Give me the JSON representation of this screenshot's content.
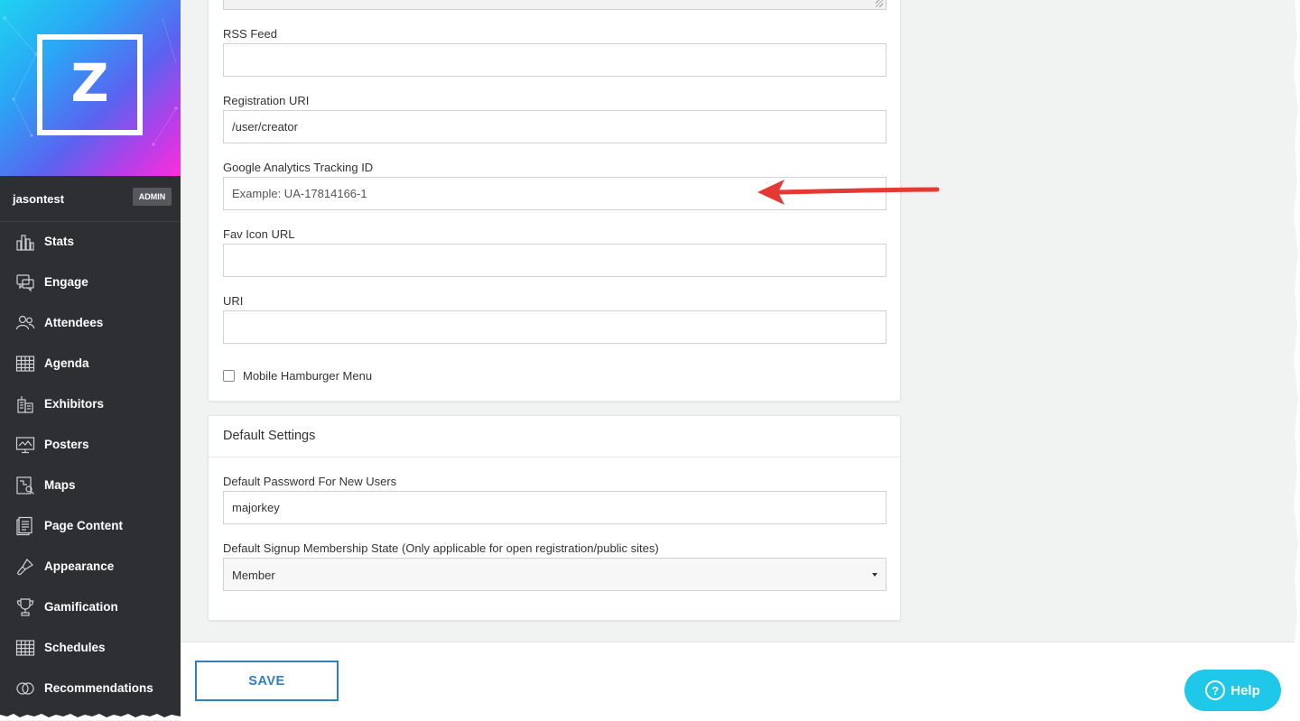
{
  "sidebar": {
    "username": "jasontest",
    "badge": "ADMIN",
    "logo_letter": "Z",
    "items": [
      {
        "label": "Stats",
        "icon": "stats-icon"
      },
      {
        "label": "Engage",
        "icon": "engage-icon"
      },
      {
        "label": "Attendees",
        "icon": "attendees-icon"
      },
      {
        "label": "Agenda",
        "icon": "agenda-icon"
      },
      {
        "label": "Exhibitors",
        "icon": "exhibitors-icon"
      },
      {
        "label": "Posters",
        "icon": "posters-icon"
      },
      {
        "label": "Maps",
        "icon": "maps-icon"
      },
      {
        "label": "Page Content",
        "icon": "page-content-icon"
      },
      {
        "label": "Appearance",
        "icon": "appearance-icon"
      },
      {
        "label": "Gamification",
        "icon": "gamification-icon"
      },
      {
        "label": "Schedules",
        "icon": "schedules-icon"
      },
      {
        "label": "Recommendations",
        "icon": "recommendations-icon"
      }
    ]
  },
  "site_settings": {
    "rss_feed": {
      "label": "RSS Feed",
      "value": ""
    },
    "registration_uri": {
      "label": "Registration URI",
      "value": "/user/creator"
    },
    "ga_tracking_id": {
      "label": "Google Analytics Tracking ID",
      "value": "",
      "placeholder": "Example: UA-17814166-1"
    },
    "fav_icon_url": {
      "label": "Fav Icon URL",
      "value": ""
    },
    "uri": {
      "label": "URI",
      "value": ""
    },
    "mobile_hamburger": {
      "label": "Mobile Hamburger Menu",
      "checked": false
    }
  },
  "default_settings": {
    "title": "Default Settings",
    "default_password": {
      "label": "Default Password For New Users",
      "value": "majorkey"
    },
    "signup_state": {
      "label": "Default Signup Membership State (Only applicable for open registration/public sites)",
      "value": "Member"
    }
  },
  "footer": {
    "save_label": "SAVE",
    "help_label": "Help",
    "help_icon_glyph": "?"
  },
  "colors": {
    "sidebar_bg": "#2d2f33",
    "save_accent": "#2f7fc1",
    "help_bg": "#1fc8e8",
    "annotation_arrow": "#e53935"
  }
}
